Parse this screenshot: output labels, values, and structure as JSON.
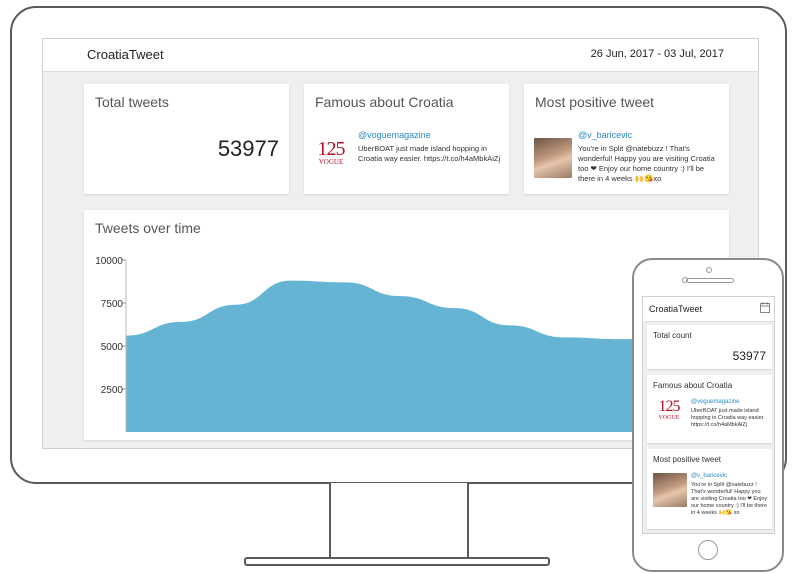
{
  "app": {
    "title": "CroatiaTweet",
    "date_range": "26 Jun, 2017 - 03 Jul, 2017"
  },
  "cards": {
    "total": {
      "title": "Total tweets",
      "value": "53977"
    },
    "famous": {
      "title": "Famous about Croatia",
      "handle": "@voguemagazine",
      "text": "UberBOAT just made island hopping in Croatia way easier. https://t.co/h4aMbkAiZj",
      "logo_number": "125",
      "logo_word": "VOGUE"
    },
    "positive": {
      "title": "Most positive tweet",
      "handle": "@v_baricevic",
      "text": "You're in Split @natebuzz ! That's wonderful! Happy you are visiting Croatia too ❤ Enjoy our home country :) I'll be there in 4 weeks 🙌😘xo"
    }
  },
  "chart": {
    "title": "Tweets over time"
  },
  "chart_data": {
    "type": "area",
    "title": "Tweets over time",
    "x": [
      0,
      1,
      2,
      3,
      4,
      5,
      6,
      7,
      8,
      9,
      10,
      11
    ],
    "values": [
      5600,
      6400,
      7400,
      8800,
      8700,
      7900,
      7200,
      6200,
      5500,
      5400,
      5400,
      5400
    ],
    "yticks": [
      "10000",
      "7500",
      "5000",
      "2500"
    ],
    "ylim": [
      0,
      10000
    ],
    "grid": false,
    "color": "#65b4d4"
  },
  "phone": {
    "title": "CroatiaTweet",
    "total": {
      "title": "Total count",
      "value": "53977"
    },
    "famous": {
      "title": "Famous about Croatia",
      "handle": "@voguemagazine",
      "text": "UberBOAT just made island hopping in Croatia way easier. https://t.co/h4aMbkAiZj",
      "logo_number": "125",
      "logo_word": "VOGUE"
    },
    "positive": {
      "title": "Most positive tweet",
      "handle": "@v_baricevic",
      "text": "You're in Split @natebuzz ! That's wonderful! Happy you are visiting Croatia too ❤ Enjoy our home country :) I'll be there in 4 weeks 🙌😘 xo"
    },
    "icons": {
      "calendar": "calendar-icon"
    }
  }
}
